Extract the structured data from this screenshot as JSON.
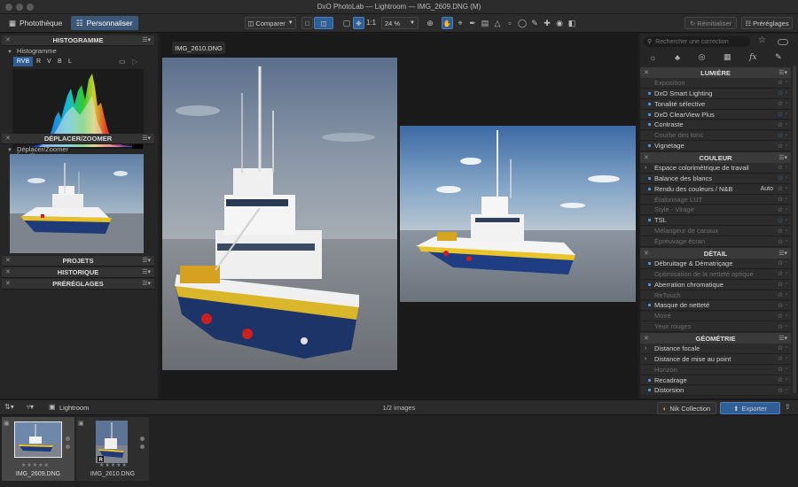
{
  "app": {
    "title": "DxO PhotoLab — Lightroom — IMG_2609.DNG (M)"
  },
  "toolbar": {
    "tab_phototheque": "Photothèque",
    "tab_personnaliser": "Personnaliser",
    "compare_label": "Comparer",
    "one_to_one": "1:1",
    "zoom": "24 %",
    "reset_label": "Réinitialiser",
    "presets_label": "Préréglages"
  },
  "left_panel": {
    "histogram_title": "HISTOGRAMME",
    "histogram_sub": "Histogramme",
    "channels": [
      "RVB",
      "R",
      "V",
      "B",
      "L"
    ],
    "move_zoom_title": "DÉPLACER/ZOOMER",
    "move_zoom_sub": "Déplacer/Zoomer",
    "projects": "PROJETS",
    "history": "HISTORIQUE",
    "presets": "PRÉRÉGLAGES"
  },
  "center": {
    "image_label": "IMG_2610.DNG"
  },
  "right_panel": {
    "search_placeholder": "Rechercher une correction",
    "sections": {
      "lumiere": "LUMIÈRE",
      "couleur": "COULEUR",
      "detail": "DÉTAIL",
      "geometrie": "GÉOMÉTRIE"
    },
    "lumiere_items": [
      {
        "label": "Exposition",
        "active": false
      },
      {
        "label": "DxO Smart Lighting",
        "active": true
      },
      {
        "label": "Tonalité sélective",
        "active": true
      },
      {
        "label": "DxO ClearView Plus",
        "active": true
      },
      {
        "label": "Contraste",
        "active": true
      },
      {
        "label": "Courbe des tons",
        "active": false
      },
      {
        "label": "Vignetage",
        "active": true
      }
    ],
    "couleur_items": [
      {
        "label": "Espace colorimétrique de travail",
        "active": true
      },
      {
        "label": "Balance des blancs",
        "active": true
      },
      {
        "label": "Rendu des couleurs / N&B",
        "active": true,
        "extra": "Auto"
      },
      {
        "label": "Étalonnage LUT",
        "active": false
      },
      {
        "label": "Style - Virage",
        "active": false
      },
      {
        "label": "TSL",
        "active": true
      },
      {
        "label": "Mélangeur de canaux",
        "active": false
      },
      {
        "label": "Épreuvage écran",
        "active": false
      }
    ],
    "detail_items": [
      {
        "label": "Débruitage & Dématriçage",
        "active": true
      },
      {
        "label": "Optimisation de la netteté optique",
        "active": false
      },
      {
        "label": "Aberration chromatique",
        "active": true
      },
      {
        "label": "ReTouch",
        "active": false
      },
      {
        "label": "Masque de netteté",
        "active": true
      },
      {
        "label": "Moiré",
        "active": false
      },
      {
        "label": "Yeux rouges",
        "active": false
      }
    ],
    "geometrie_items": [
      {
        "label": "Distance focale",
        "active": true
      },
      {
        "label": "Distance de mise au point",
        "active": true
      },
      {
        "label": "Horizon",
        "active": false
      },
      {
        "label": "Recadrage",
        "active": true
      },
      {
        "label": "Distorsion",
        "active": true
      }
    ]
  },
  "bottom": {
    "source": "Lightroom",
    "count": "1/2 images",
    "nik": "Nik Collection",
    "export": "Exporter"
  },
  "filmstrip": {
    "items": [
      "IMG_2609.DNG",
      "IMG_2610.DNG"
    ]
  },
  "colors": {
    "accent": "#2f5f96",
    "bg": "#1e1e1e"
  }
}
